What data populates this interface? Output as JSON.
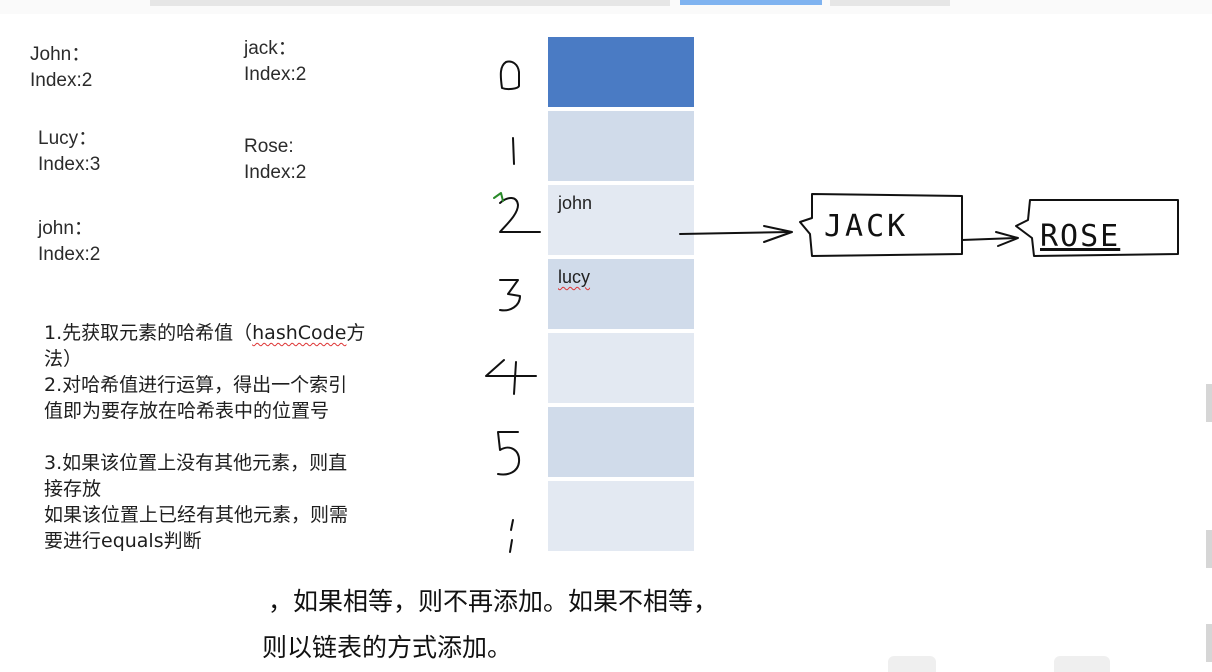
{
  "left_labels": [
    {
      "name": "John：",
      "index": "Index:2"
    },
    {
      "name": "Lucy：",
      "index": "Index:3"
    },
    {
      "name": "john：",
      "index": "Index:2"
    }
  ],
  "right_labels": [
    {
      "name": "jack：",
      "index": "Index:2"
    },
    {
      "name": "Rose:",
      "index": "Index:2"
    }
  ],
  "slot_numbers": [
    "0",
    "1",
    "2",
    "3",
    "4",
    "5",
    "6"
  ],
  "hash_table": {
    "cells": [
      {
        "text": "",
        "color": "#4a7bc4"
      },
      {
        "text": "",
        "color": "#d0dbea"
      },
      {
        "text": "john",
        "color": "#e3e9f2"
      },
      {
        "text": "lucy",
        "color": "#d0dbea"
      },
      {
        "text": "",
        "color": "#e3e9f2"
      },
      {
        "text": "",
        "color": "#d0dbea"
      },
      {
        "text": "",
        "color": "#e3e9f2"
      }
    ]
  },
  "chain_nodes": [
    "JACK",
    "ROSE"
  ],
  "steps": {
    "step1_a": "1.先获取元素的哈希值（",
    "step1_code": "hashCode",
    "step1_b": "方",
    "step1_c": "法）",
    "step2_a": "2.对哈希值进行运算，得出一个索引",
    "step2_b": "值即为要存放在哈希表中的位置号",
    "step3_a": "3.如果该位置上没有其他元素，则直",
    "step3_b": "接存放",
    "step3_c": "如果该位置上已经有其他元素，则需",
    "step3_d": "要进行equals判断"
  },
  "continuation_line1": "，如果相等，则不再添加。如果不相等，",
  "continuation_line2": "则以链表的方式添加。"
}
